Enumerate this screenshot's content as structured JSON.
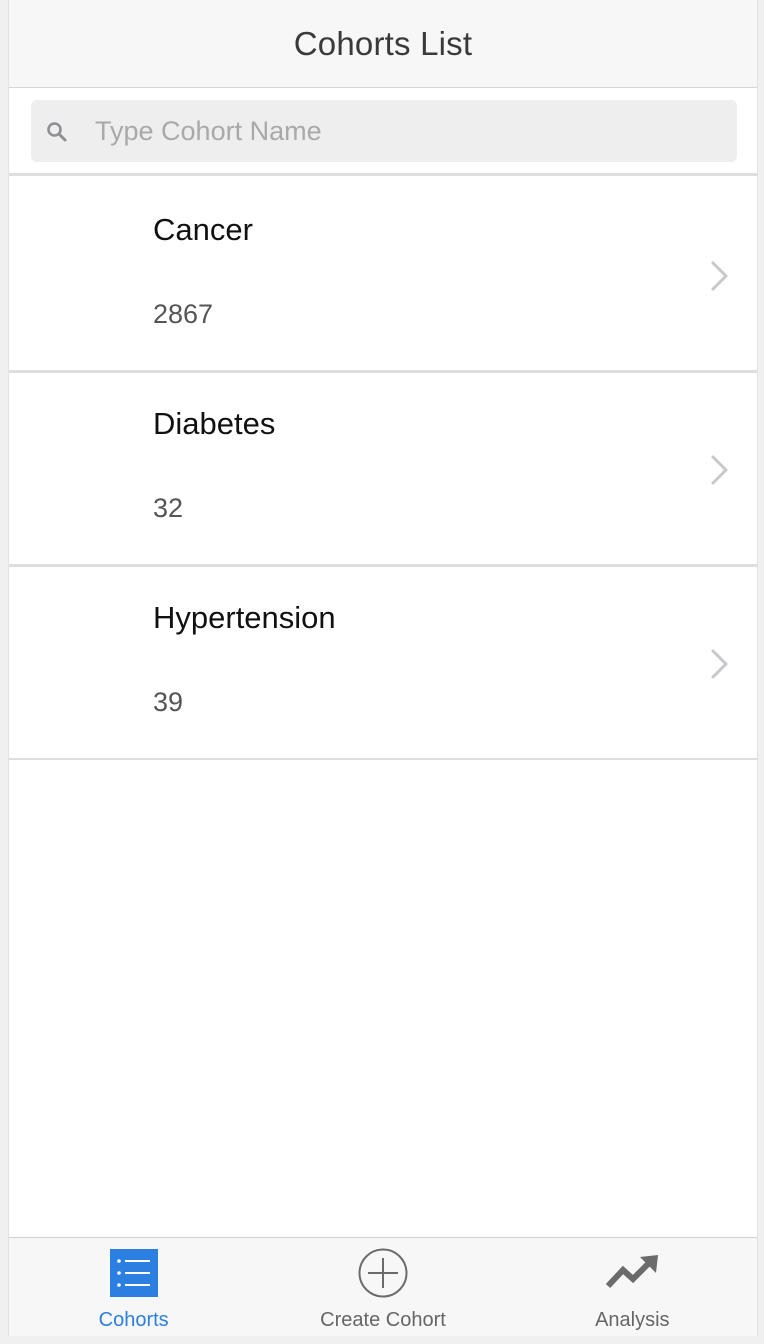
{
  "header": {
    "title": "Cohorts List"
  },
  "search": {
    "placeholder": "Type Cohort Name",
    "value": ""
  },
  "cohorts": [
    {
      "name": "Cancer",
      "count": "2867"
    },
    {
      "name": "Diabetes",
      "count": "32"
    },
    {
      "name": "Hypertension",
      "count": "39"
    }
  ],
  "tabs": [
    {
      "label": "Cohorts",
      "icon": "list-icon",
      "active": true
    },
    {
      "label": "Create Cohort",
      "icon": "plus-circle-icon",
      "active": false
    },
    {
      "label": "Analysis",
      "icon": "trend-up-icon",
      "active": false
    }
  ],
  "colors": {
    "accent": "#2b7fe0",
    "inactive": "#666666",
    "chevron": "#c7c7cc"
  }
}
